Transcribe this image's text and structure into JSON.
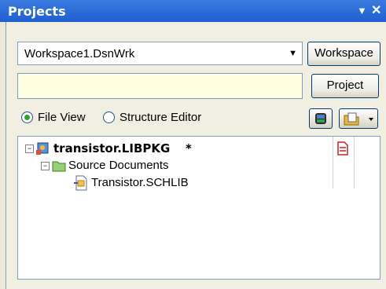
{
  "panel": {
    "title": "Projects"
  },
  "workspace": {
    "combo_value": "Workspace1.DsnWrk",
    "button_label": "Workspace"
  },
  "project": {
    "field_value": "",
    "button_label": "Project"
  },
  "view_mode": {
    "file_view_label": "File View",
    "structure_editor_label": "Structure Editor",
    "selected": "File View"
  },
  "tree": {
    "project_name": "transistor.LIBPKG",
    "modified_flag": "*",
    "folder_label": "Source Documents",
    "document_label": "Transistor.SCHLIB"
  },
  "colors": {
    "title_bar": "#2a6be0",
    "radio_selected": "#2fa12f",
    "project_field_bg": "#ffffe1"
  }
}
